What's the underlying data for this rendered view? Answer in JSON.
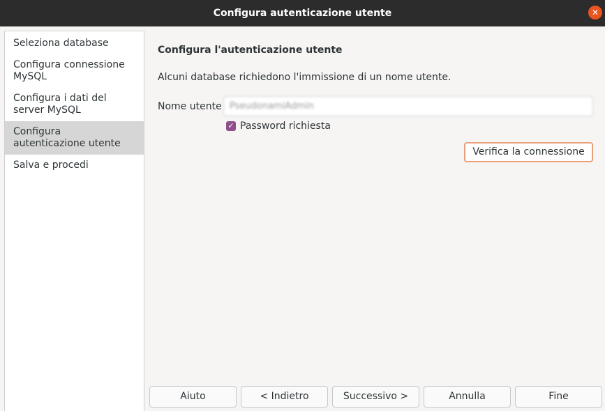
{
  "window": {
    "title": "Configura autenticazione utente",
    "close_glyph": "✕"
  },
  "sidebar": {
    "items": [
      {
        "label": "Seleziona database"
      },
      {
        "label": "Configura connessione MySQL"
      },
      {
        "label": "Configura i dati del server MySQL"
      },
      {
        "label": "Configura autenticazione utente",
        "active": true
      },
      {
        "label": "Salva e procedi"
      }
    ]
  },
  "main": {
    "heading": "Configura l'autenticazione utente",
    "description": "Alcuni database richiedono l'immissione di un nome utente.",
    "username_label": "Nome utente",
    "username_value": "PseudonamiAdmin",
    "password_required_label": "Password richiesta",
    "password_required_checked": true,
    "verify_button": "Verifica la connessione"
  },
  "buttons": {
    "help": "Aiuto",
    "back": "< Indietro",
    "next": "Successivo >",
    "cancel": "Annulla",
    "finish": "Fine"
  },
  "colors": {
    "titlebar": "#2c2c2c",
    "close": "#e95420",
    "checkbox": "#8f4f8d",
    "focus_border": "#e9a07a",
    "active_step": "#d6d6d6"
  }
}
